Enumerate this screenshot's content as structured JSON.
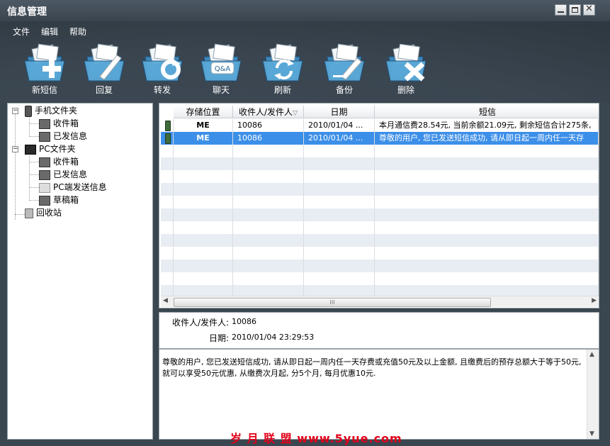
{
  "window": {
    "title": "信息管理"
  },
  "menu": [
    "文件",
    "编辑",
    "帮助"
  ],
  "toolbar": [
    {
      "label": "新短信",
      "icon": "new-message-icon"
    },
    {
      "label": "回复",
      "icon": "reply-icon"
    },
    {
      "label": "转发",
      "icon": "forward-icon"
    },
    {
      "label": "聊天",
      "icon": "chat-icon"
    },
    {
      "label": "刷新",
      "icon": "refresh-icon"
    },
    {
      "label": "备份",
      "icon": "backup-icon"
    },
    {
      "label": "删除",
      "icon": "delete-icon"
    }
  ],
  "tree": {
    "phone": {
      "label": "手机文件夹",
      "children": [
        "收件箱",
        "已发信息"
      ]
    },
    "pc": {
      "label": "PC文件夹",
      "children": [
        "收件箱",
        "已发信息",
        "PC端发送信息",
        "草稿箱"
      ]
    },
    "recycle": "回收站"
  },
  "list": {
    "columns": [
      "存储位置",
      "收件人/发件人",
      "日期",
      "短信"
    ],
    "rows": [
      {
        "location": "ME",
        "contact": "10086",
        "date": "2010/01/04 ...",
        "message": "本月通信费28.54元, 当前余额21.09元, 剩余短信合计275条,",
        "selected": false
      },
      {
        "location": "ME",
        "contact": "10086",
        "date": "2010/01/04 ...",
        "message": "尊敬的用户, 您已发送短信成功, 请从即日起一周内任一天存",
        "selected": true
      }
    ],
    "scroll_thumb_label": "III"
  },
  "detail": {
    "contact_label": "收件人/发件人:",
    "contact_value": "10086",
    "date_label": "日期:",
    "date_value": "2010/01/04 23:29:53"
  },
  "body": {
    "text": "尊敬的用户, 您已发送短信成功, 请从即日起一周内任一天存费或充值50元及以上金额, 且缴费后的预存总额大于等于50元, 就可以享受50元优惠, 从缴费次月起, 分5个月, 每月优惠10元."
  },
  "watermark": "岁 月 联 盟   www.5yue.com",
  "colors": {
    "titlebar": "#3f4a54",
    "selection": "#3c8fe8",
    "stripe": "#e8edf3"
  }
}
